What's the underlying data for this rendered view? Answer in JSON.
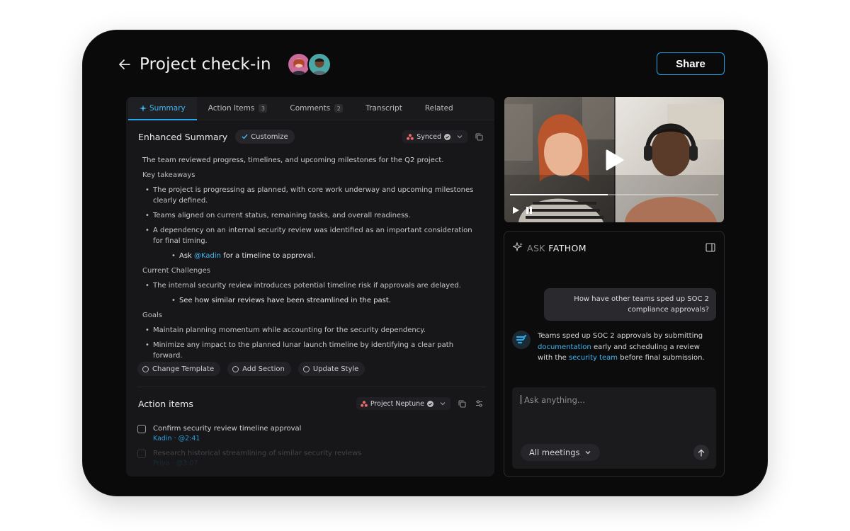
{
  "header": {
    "title": "Project check-in",
    "share_label": "Share"
  },
  "colors": {
    "accent": "#1ea7e8",
    "background": "#0a0a0b",
    "panel": "#17171a"
  },
  "tabs": [
    {
      "label": "Summary",
      "badge": ""
    },
    {
      "label": "Action Items",
      "badge": "3"
    },
    {
      "label": "Comments",
      "badge": "2"
    },
    {
      "label": "Transcript",
      "badge": ""
    },
    {
      "label": "Related",
      "badge": ""
    }
  ],
  "summary": {
    "title": "Enhanced Summary",
    "customize_label": "Customize",
    "synced_label": "Synced",
    "intro": "The team reviewed progress, timelines, and upcoming milestones for the Q2 project.",
    "key_takeaways_heading": "Key takeaways",
    "takeaways": [
      "The project is progressing as planned, with core work underway and upcoming milestones clearly defined.",
      "Teams aligned on current status, remaining tasks, and overall readiness.",
      "A dependency on an internal security review was identified as an important consideration for final timing."
    ],
    "nested_ask_prefix": "Ask",
    "nested_ask_mention": "@Kadin",
    "nested_ask_suffix": "for a timeline to approval.",
    "challenges_heading": "Current Challenges",
    "challenges": [
      "The internal security review introduces potential timeline risk if approvals are delayed."
    ],
    "challenges_nested": "See how similar reviews have been streamlined in the past.",
    "goals_heading": "Goals",
    "goals": [
      "Maintain planning momentum while accounting for the security dependency.",
      "Minimize any impact to the planned lunar launch timeline by identifying a clear path forward."
    ],
    "chips": [
      "Change Template",
      "Add Section",
      "Update Style"
    ]
  },
  "action_items": {
    "title": "Action items",
    "project_label": "Project Neptune",
    "items": [
      {
        "text": "Confirm security review timeline approval",
        "meta": "Kadin · @2:41"
      },
      {
        "text": "Research historical streamlining of similar security reviews",
        "meta": "Priya · @3:07"
      }
    ]
  },
  "video": {
    "progress": 0.47
  },
  "ask": {
    "label_prefix": "ASK",
    "label_brand": "FATHOM",
    "user_message": "How have other teams sped up SOC 2 compliance approvals?",
    "bot_part1": "Teams sped up SOC 2 approvals by submitting",
    "bot_link1": "documentation",
    "bot_part2": "early and scheduling a review with the",
    "bot_link2": "security team",
    "bot_part3": "before final submission.",
    "input_placeholder": "Ask anything...",
    "scope_label": "All meetings"
  }
}
